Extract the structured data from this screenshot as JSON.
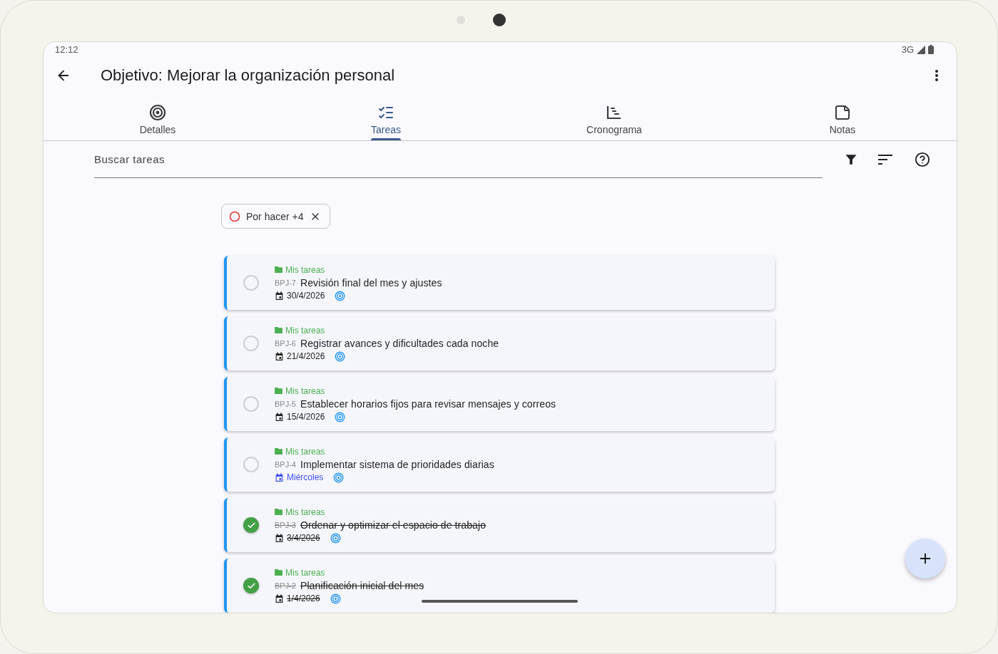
{
  "status_bar": {
    "time": "12:12",
    "network": "3G"
  },
  "app_bar": {
    "title": "Objetivo: Mejorar la organización personal"
  },
  "tabs": [
    {
      "label": "Detalles",
      "kind": "target",
      "selected": false
    },
    {
      "label": "Tareas",
      "kind": "checklist",
      "selected": true
    },
    {
      "label": "Cronograma",
      "kind": "timeline",
      "selected": false
    },
    {
      "label": "Notas",
      "kind": "note",
      "selected": false
    }
  ],
  "search": {
    "placeholder": "Buscar tareas"
  },
  "filter_chip": {
    "label": "Por hacer +4"
  },
  "tasks": [
    {
      "list": "Mis tareas",
      "code": "BPJ-7",
      "title": "Revisión final del mes y ajustes",
      "date": "30/4/2026",
      "completed": false,
      "highlight": false
    },
    {
      "list": "Mis tareas",
      "code": "BPJ-6",
      "title": "Registrar avances y dificultades cada noche",
      "date": "21/4/2026",
      "completed": false,
      "highlight": false
    },
    {
      "list": "Mis tareas",
      "code": "BPJ-5",
      "title": "Establecer horarios fijos para revisar mensajes y correos",
      "date": "15/4/2026",
      "completed": false,
      "highlight": false
    },
    {
      "list": "Mis tareas",
      "code": "BPJ-4",
      "title": "Implementar sistema de prioridades diarias",
      "date": "Miércoles",
      "completed": false,
      "highlight": true
    },
    {
      "list": "Mis tareas",
      "code": "BPJ-3",
      "title": "Ordenar y optimizar el espacio de trabajo",
      "date": "3/4/2026",
      "completed": true,
      "highlight": false
    },
    {
      "list": "Mis tareas",
      "code": "BPJ-2",
      "title": "Planificación inicial del mes",
      "date": "1/4/2026",
      "completed": true,
      "highlight": false
    }
  ]
}
